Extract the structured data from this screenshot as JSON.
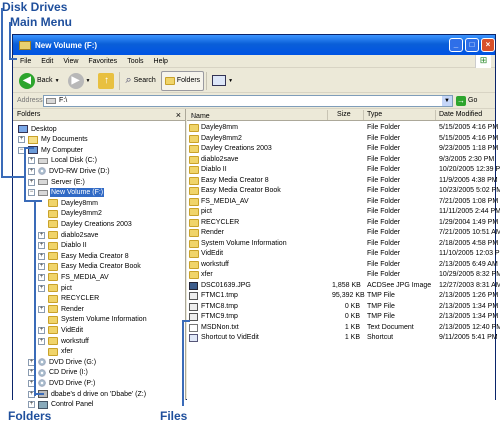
{
  "callouts": {
    "disk_drives": "Disk Drives",
    "main_menu": "Main Menu",
    "folders": "Folders",
    "files": "Files"
  },
  "window": {
    "title": "New Volume (F:)",
    "title_buttons": {
      "minimize": "_",
      "maximize": "□",
      "close": "×"
    }
  },
  "menu": [
    "File",
    "Edit",
    "View",
    "Favorites",
    "Tools",
    "Help"
  ],
  "toolbar": {
    "back": "Back",
    "search": "Search",
    "folders": "Folders"
  },
  "address": {
    "label": "Address",
    "value": "F:\\",
    "go": "Go"
  },
  "folders_pane": {
    "title": "Folders",
    "close": "×",
    "tree": [
      {
        "label": "Desktop",
        "icon": "desktop-icon",
        "level": 0,
        "expander": ""
      },
      {
        "label": "My Documents",
        "icon": "my-documents-icon",
        "level": 1,
        "expander": "+"
      },
      {
        "label": "My Computer",
        "icon": "my-computer-icon",
        "level": 1,
        "expander": "−"
      },
      {
        "label": "Local Disk (C:)",
        "icon": "hard-drive-icon",
        "level": 2,
        "expander": "+"
      },
      {
        "label": "DVD-RW Drive (D:)",
        "icon": "cd-drive-icon",
        "level": 2,
        "expander": "+"
      },
      {
        "label": "Server (E:)",
        "icon": "hard-drive-icon",
        "level": 2,
        "expander": "+"
      },
      {
        "label": "New Volume (F:)",
        "icon": "hard-drive-icon",
        "level": 2,
        "expander": "−",
        "selected": true
      },
      {
        "label": "Dayley8mm",
        "icon": "folder-icon",
        "level": 3,
        "expander": ""
      },
      {
        "label": "Dayley8mm2",
        "icon": "folder-icon",
        "level": 3,
        "expander": ""
      },
      {
        "label": "Dayley Creations 2003",
        "icon": "folder-icon",
        "level": 3,
        "expander": ""
      },
      {
        "label": "diablo2save",
        "icon": "folder-icon",
        "level": 3,
        "expander": "+"
      },
      {
        "label": "Diablo II",
        "icon": "folder-icon",
        "level": 3,
        "expander": "+"
      },
      {
        "label": "Easy Media Creator 8",
        "icon": "folder-icon",
        "level": 3,
        "expander": "+"
      },
      {
        "label": "Easy Media Creator Book",
        "icon": "folder-icon",
        "level": 3,
        "expander": "+"
      },
      {
        "label": "FS_MEDIA_AV",
        "icon": "folder-icon",
        "level": 3,
        "expander": "+"
      },
      {
        "label": "pict",
        "icon": "folder-icon",
        "level": 3,
        "expander": "+"
      },
      {
        "label": "RECYCLER",
        "icon": "folder-icon",
        "level": 3,
        "expander": ""
      },
      {
        "label": "Render",
        "icon": "folder-icon",
        "level": 3,
        "expander": "+"
      },
      {
        "label": "System Volume Information",
        "icon": "folder-icon",
        "level": 3,
        "expander": ""
      },
      {
        "label": "VidEdit",
        "icon": "folder-icon",
        "level": 3,
        "expander": "+"
      },
      {
        "label": "workstuff",
        "icon": "folder-icon",
        "level": 3,
        "expander": "+"
      },
      {
        "label": "xfer",
        "icon": "folder-icon",
        "level": 3,
        "expander": ""
      },
      {
        "label": "DVD Drive (G:)",
        "icon": "cd-drive-icon",
        "level": 2,
        "expander": "+"
      },
      {
        "label": "CD Drive (I:)",
        "icon": "cd-drive-icon",
        "level": 2,
        "expander": "+"
      },
      {
        "label": "DVD Drive (P:)",
        "icon": "cd-drive-icon",
        "level": 2,
        "expander": "+"
      },
      {
        "label": "dbabe's d drive on 'Dbabe' (Z:)",
        "icon": "network-drive-icon",
        "level": 2,
        "expander": "+"
      },
      {
        "label": "Control Panel",
        "icon": "control-panel-icon",
        "level": 2,
        "expander": "+"
      }
    ]
  },
  "files_pane": {
    "columns": {
      "name": "Name",
      "size": "Size",
      "type": "Type",
      "date": "Date Modified",
      "sort_indicator": "▲"
    },
    "rows": [
      {
        "name": "Dayley8mm",
        "size": "",
        "type": "File Folder",
        "date": "5/15/2005 4:16 PM",
        "icon": "folder-icon"
      },
      {
        "name": "Dayley8mm2",
        "size": "",
        "type": "File Folder",
        "date": "5/15/2005 4:16 PM",
        "icon": "folder-icon"
      },
      {
        "name": "Dayley Creations 2003",
        "size": "",
        "type": "File Folder",
        "date": "9/23/2005 1:18 PM",
        "icon": "folder-icon"
      },
      {
        "name": "diablo2save",
        "size": "",
        "type": "File Folder",
        "date": "9/3/2005 2:30 PM",
        "icon": "folder-icon"
      },
      {
        "name": "Diablo II",
        "size": "",
        "type": "File Folder",
        "date": "10/20/2005 12:39 PM",
        "icon": "folder-icon"
      },
      {
        "name": "Easy Media Creator 8",
        "size": "",
        "type": "File Folder",
        "date": "11/9/2005 4:38 PM",
        "icon": "folder-icon"
      },
      {
        "name": "Easy Media Creator Book",
        "size": "",
        "type": "File Folder",
        "date": "10/23/2005 5:02 PM",
        "icon": "folder-icon"
      },
      {
        "name": "FS_MEDIA_AV",
        "size": "",
        "type": "File Folder",
        "date": "7/21/2005 1:08 PM",
        "icon": "folder-icon"
      },
      {
        "name": "pict",
        "size": "",
        "type": "File Folder",
        "date": "11/11/2005 2:44 PM",
        "icon": "folder-icon"
      },
      {
        "name": "RECYCLER",
        "size": "",
        "type": "File Folder",
        "date": "1/29/2004 1:49 PM",
        "icon": "folder-icon"
      },
      {
        "name": "Render",
        "size": "",
        "type": "File Folder",
        "date": "7/21/2005 10:51 AM",
        "icon": "folder-icon"
      },
      {
        "name": "System Volume Information",
        "size": "",
        "type": "File Folder",
        "date": "2/18/2005 4:58 PM",
        "icon": "folder-icon"
      },
      {
        "name": "VidEdit",
        "size": "",
        "type": "File Folder",
        "date": "11/10/2005 12:03 PM",
        "icon": "folder-icon"
      },
      {
        "name": "workstuff",
        "size": "",
        "type": "File Folder",
        "date": "2/13/2005 6:49 AM",
        "icon": "folder-icon"
      },
      {
        "name": "xfer",
        "size": "",
        "type": "File Folder",
        "date": "10/29/2005 8:32 PM",
        "icon": "folder-icon"
      },
      {
        "name": "DSC01639.JPG",
        "size": "1,858 KB",
        "type": "ACDSee JPG Image",
        "date": "12/27/2003 8:31 AM",
        "icon": "jpg-file-icon"
      },
      {
        "name": "FTMC1.tmp",
        "size": "95,392 KB",
        "type": "TMP File",
        "date": "2/13/2005 1:26 PM",
        "icon": "tmp-file-icon"
      },
      {
        "name": "FTMC8.tmp",
        "size": "0 KB",
        "type": "TMP File",
        "date": "2/13/2005 1:34 PM",
        "icon": "tmp-file-icon"
      },
      {
        "name": "FTMC9.tmp",
        "size": "0 KB",
        "type": "TMP File",
        "date": "2/13/2005 1:34 PM",
        "icon": "tmp-file-icon"
      },
      {
        "name": "MSDNon.txt",
        "size": "1 KB",
        "type": "Text Document",
        "date": "2/13/2005 12:40 PM",
        "icon": "text-file-icon"
      },
      {
        "name": "Shortcut to VidEdit",
        "size": "1 KB",
        "type": "Shortcut",
        "date": "9/11/2005 5:41 PM",
        "icon": "shortcut-icon"
      }
    ]
  }
}
